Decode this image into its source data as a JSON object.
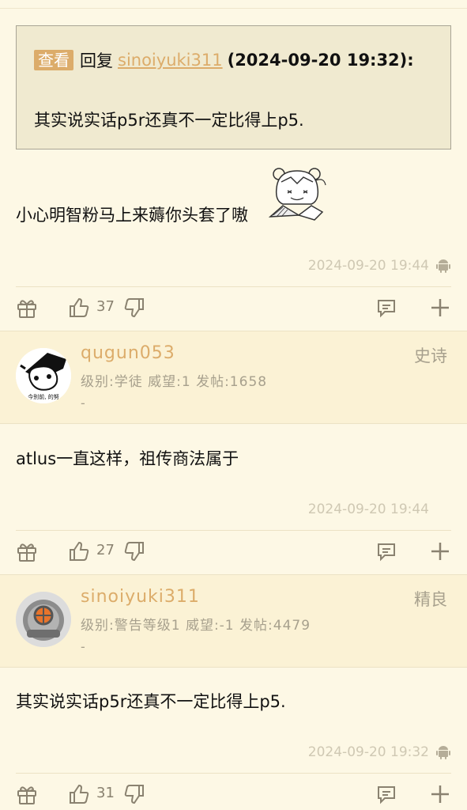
{
  "quote": {
    "view_label": "查看",
    "reply_word": "回复",
    "user": "sinoiyuki311",
    "time": "(2024-09-20 19:32):",
    "text": "其实说实话p5r还真不一定比得上p5."
  },
  "post1": {
    "text": "小心明智粉马上来薅你头套了嗷",
    "timestamp": "2024-09-20 19:44",
    "likes": "37"
  },
  "post2": {
    "username": "qugun053",
    "meta": "级别:学徒  威望:1  发帖:1658",
    "dash": "-",
    "rank": "史诗",
    "avatar_caption": "今别前, 的努",
    "text": "atlus一直这样，祖传商法属于",
    "timestamp": "2024-09-20 19:44",
    "likes": "27"
  },
  "post3": {
    "username": "sinoiyuki311",
    "meta": "级别:警告等级1  威望:-1  发帖:4479",
    "dash": "-",
    "rank": "精良",
    "text": "其实说实话p5r还真不一定比得上p5.",
    "timestamp": "2024-09-20 19:32",
    "likes": "31"
  },
  "colors": {
    "background": "#fdf8e5",
    "user_band": "#fbf2d5",
    "accent": "#dcac6a",
    "muted": "#a7a08d"
  },
  "icons": [
    "gift-icon",
    "thumbs-up-icon",
    "thumbs-down-icon",
    "comment-icon",
    "plus-icon",
    "android-icon"
  ]
}
